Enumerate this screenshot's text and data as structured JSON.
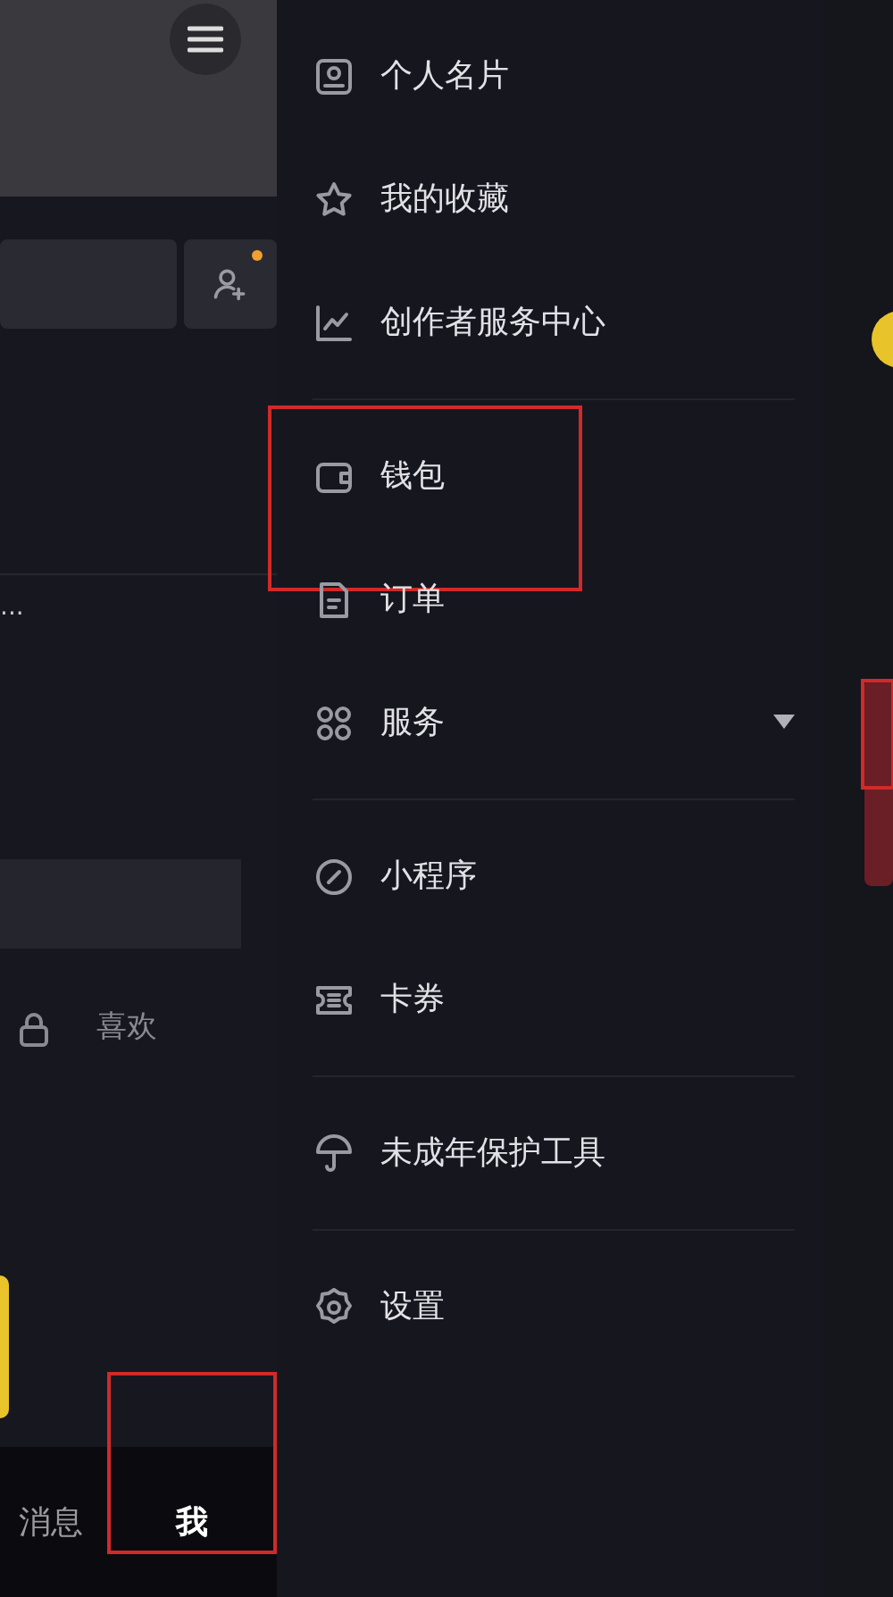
{
  "profile": {
    "more_text": "...",
    "tab_label": "喜欢",
    "bottom_nav": [
      {
        "label": "消息",
        "selected": false,
        "highlighted": false
      },
      {
        "label": "我",
        "selected": true,
        "highlighted": true
      }
    ]
  },
  "menu": {
    "groups": [
      [
        {
          "label": "个人名片",
          "highlighted": false
        },
        {
          "label": "我的收藏",
          "highlighted": false
        },
        {
          "label": "创作者服务中心",
          "highlighted": false
        }
      ],
      [
        {
          "label": "钱包",
          "highlighted": true
        },
        {
          "label": "订单",
          "highlighted": false
        },
        {
          "label": "服务",
          "highlighted": false,
          "expandable": true
        }
      ],
      [
        {
          "label": "小程序",
          "highlighted": false
        },
        {
          "label": "卡券",
          "highlighted": false
        }
      ],
      [
        {
          "label": "未成年保护工具",
          "highlighted": false
        }
      ],
      [
        {
          "label": "设置",
          "highlighted": false
        }
      ]
    ]
  }
}
